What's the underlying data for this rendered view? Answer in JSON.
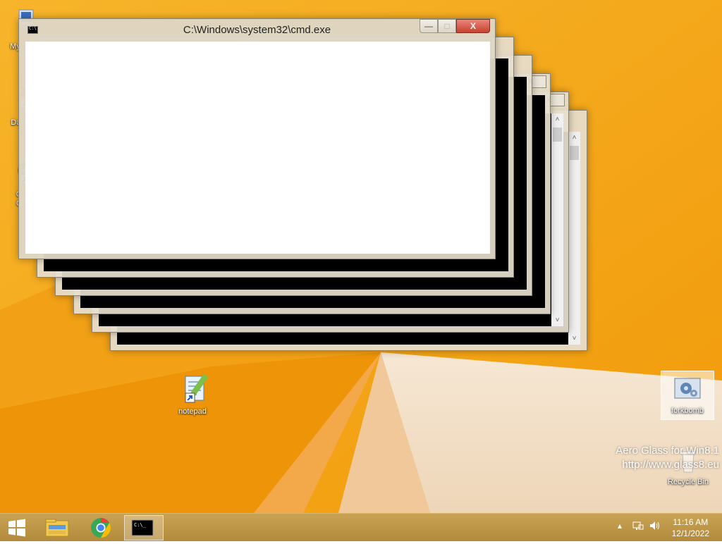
{
  "desktop": {
    "icons": [
      {
        "label": "My C",
        "icon": "computer-icon"
      },
      {
        "label": "Data",
        "icon": "broken-shortcut-icon"
      },
      {
        "label": "G\nC",
        "icon": "chrome-icon"
      },
      {
        "label": "notepad",
        "icon": "notepad-icon"
      },
      {
        "label": "forkbomb",
        "icon": "settings-batch-icon"
      },
      {
        "label": "Recycle Bin",
        "icon": "recycle-bin-icon"
      }
    ]
  },
  "window": {
    "title": "C:\\Windows\\system32\\cmd.exe",
    "min_label": "—",
    "max_label": "□",
    "close_label": "X"
  },
  "background_windows": {
    "close_label": "X",
    "min_label": "—",
    "max_label": "□",
    "scroll_up": "˄",
    "scroll_down": "˅"
  },
  "watermark": {
    "line1": "Aero Glass for Win8.1",
    "line2": "http://www.glass8.eu"
  },
  "taskbar": {
    "apps": [
      "start-icon",
      "file-explorer-icon",
      "chrome-icon",
      "cmd-icon"
    ],
    "time": "11:16 AM",
    "date": "12/1/2022",
    "tray_up": "▴"
  }
}
